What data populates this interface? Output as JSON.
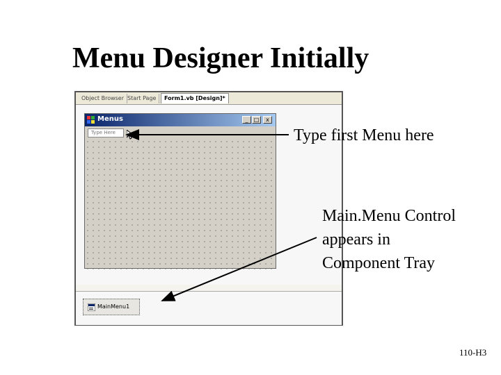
{
  "slide": {
    "title": "Menu Designer Initially",
    "footer": "110-H3"
  },
  "ide": {
    "tabs": [
      {
        "label": "Object Browser"
      },
      {
        "label": "Start Page"
      },
      {
        "label": "Form1.vb [Design]*"
      }
    ],
    "form": {
      "title": "Menus",
      "menu_placeholder": "Type Here",
      "buttons": [
        "_",
        "□",
        "x"
      ]
    },
    "tray": {
      "component_label": "MainMenu1"
    }
  },
  "annotations": {
    "menu_callout": "Type first Menu here",
    "tray_callout_lines": [
      "Main.Menu Control",
      "appears in",
      "Component Tray"
    ]
  }
}
